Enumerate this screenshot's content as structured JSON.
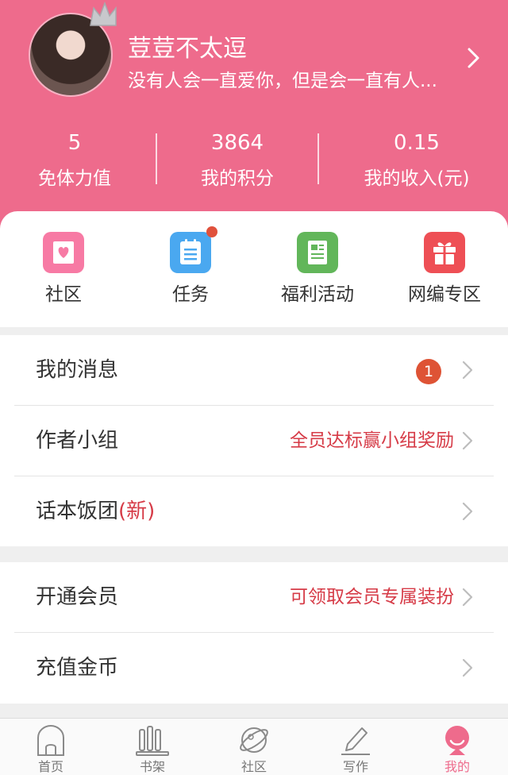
{
  "profile": {
    "name": "荳荳不太逗",
    "bio": "没有人会一直爱你，但是会一直有人..."
  },
  "stats": [
    {
      "value": "5",
      "label": "免体力值"
    },
    {
      "value": "3864",
      "label": "我的积分"
    },
    {
      "value": "0.15",
      "label": "我的收入(元)"
    }
  ],
  "quick": [
    {
      "label": "社区",
      "icon": "community-icon",
      "color": "#f77aa4"
    },
    {
      "label": "任务",
      "icon": "task-clipboard-icon",
      "color": "#4aa8f0",
      "has_dot": true
    },
    {
      "label": "福利活动",
      "icon": "welfare-news-icon",
      "color": "#62b65a"
    },
    {
      "label": "网编专区",
      "icon": "gift-icon",
      "color": "#ee4f55"
    }
  ],
  "menu1": {
    "messages": {
      "label": "我的消息",
      "badge": "1"
    },
    "author_group": {
      "label": "作者小组",
      "hint": "全员达标赢小组奖励"
    },
    "fan_group": {
      "label": "话本饭团",
      "tag": "(新)"
    }
  },
  "menu2": {
    "membership": {
      "label": "开通会员",
      "hint": "可领取会员专属装扮"
    },
    "recharge": {
      "label": "充值金币"
    }
  },
  "tabs": [
    {
      "label": "首页",
      "icon": "home-icon"
    },
    {
      "label": "书架",
      "icon": "bookshelf-icon"
    },
    {
      "label": "社区",
      "icon": "planet-icon"
    },
    {
      "label": "写作",
      "icon": "pencil-icon"
    },
    {
      "label": "我的",
      "icon": "profile-icon",
      "active": true
    }
  ],
  "colors": {
    "brand_pink": "#ee6b8c",
    "alert_red": "#d63b47",
    "badge_orange": "#de5335"
  }
}
